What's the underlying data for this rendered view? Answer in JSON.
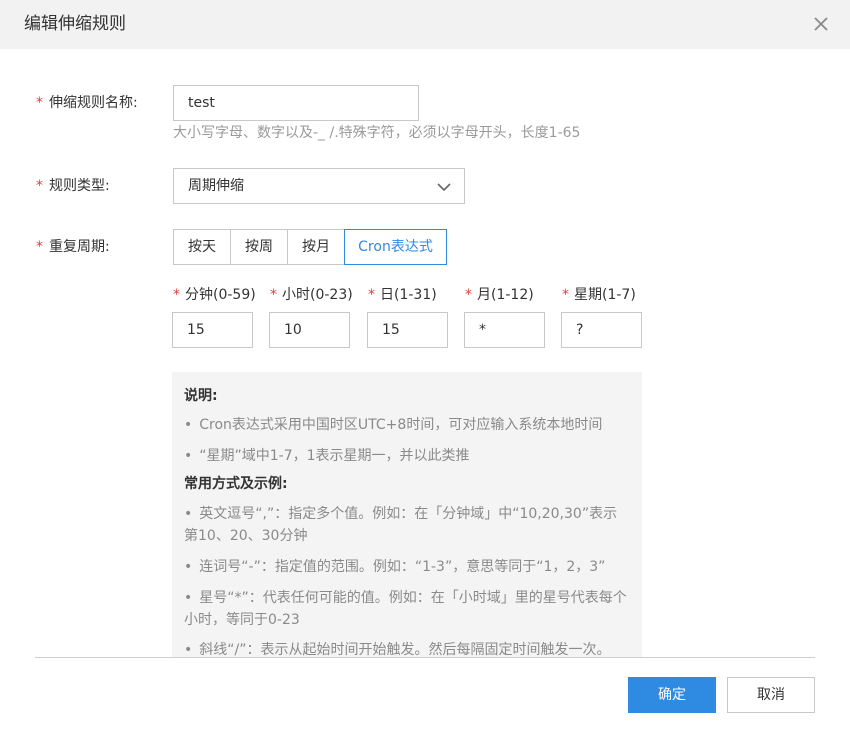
{
  "dialog": {
    "title": "编辑伸缩规则",
    "close_icon": "close-icon"
  },
  "form": {
    "required_mark": "*",
    "name": {
      "label": "伸缩规则名称:",
      "value": "test",
      "hint": "大小写字母、数字以及-_ /.特殊字符，必须以字母开头，长度1-65"
    },
    "rule_type": {
      "label": "规则类型:",
      "selected": "周期伸缩",
      "icon": "chevron-down-icon"
    },
    "repeat": {
      "label": "重复周期:",
      "tabs": [
        {
          "label": "按天",
          "active": false
        },
        {
          "label": "按周",
          "active": false
        },
        {
          "label": "按月",
          "active": false
        },
        {
          "label": "Cron表达式",
          "active": true
        }
      ]
    },
    "cron_fields": [
      {
        "label": "分钟(0-59)",
        "value": "15"
      },
      {
        "label": "小时(0-23)",
        "value": "10"
      },
      {
        "label": "日(1-31)",
        "value": "15"
      },
      {
        "label": "月(1-12)",
        "value": "*"
      },
      {
        "label": "星期(1-7)",
        "value": "?"
      }
    ]
  },
  "info": {
    "heading_1": "说明:",
    "notes": [
      "Cron表达式采用中国时区UTC+8时间，可对应输入系统本地时间",
      "“星期”域中1-7，1表示星期一，并以此类推"
    ],
    "heading_2": "常用方式及示例:",
    "examples": [
      "英文逗号“,”：指定多个值。例如：在「分钟域」中“10,20,30”表示第10、20、30分钟",
      "连词号“-”：指定值的范围。例如：“1-3”，意思等同于“1，2，3”",
      "星号“*”：代表任何可能的值。例如：在「小时域」里的星号代表每个小时，等同于0-23",
      "斜线“/”：表示从起始时间开始触发。然后每隔固定时间触发一次。"
    ],
    "bullet": "•"
  },
  "footer": {
    "confirm_label": "确定",
    "cancel_label": "取消"
  },
  "colors": {
    "accent": "#2f8ae2",
    "required": "#e0413b",
    "header_bg": "#f2f2f2",
    "info_bg": "#f4f4f4"
  }
}
